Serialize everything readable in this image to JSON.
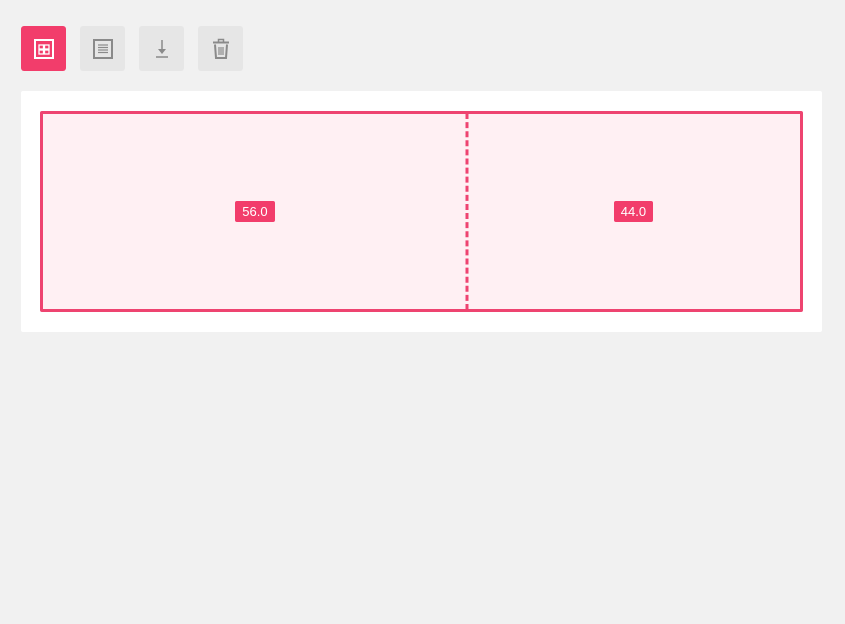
{
  "toolbar": {
    "buttons": [
      {
        "id": "columns",
        "icon": "columns-layout-icon",
        "active": true
      },
      {
        "id": "rows",
        "icon": "rows-layout-icon",
        "active": false
      },
      {
        "id": "download",
        "icon": "download-icon",
        "active": false
      },
      {
        "id": "delete",
        "icon": "trash-icon",
        "active": false
      }
    ]
  },
  "layout": {
    "columns": [
      {
        "label": "56.0",
        "percent": 56.0
      },
      {
        "label": "44.0",
        "percent": 44.0
      }
    ]
  },
  "colors": {
    "accent": "#f23d6b",
    "border": "#ee4470",
    "fill": "#fff0f3",
    "button_bg": "#e6e6e6",
    "icon_gray": "#8a8a8a",
    "page_bg": "#f1f1f1"
  }
}
